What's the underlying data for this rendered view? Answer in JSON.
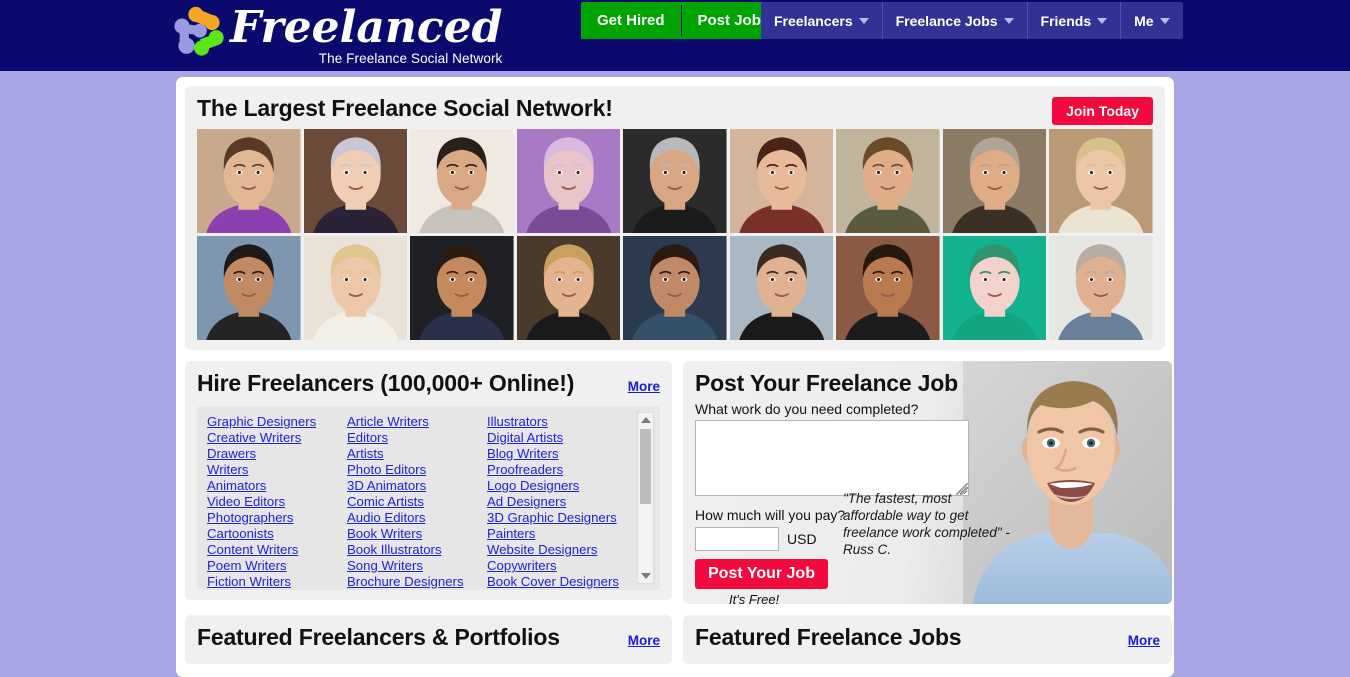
{
  "header": {
    "brand_name": "Freelanced",
    "brand_tagline": "The Freelance Social Network",
    "logo_icon": "molecule-network-icon",
    "cta": [
      {
        "label": "Get Hired",
        "name": "get-hired"
      },
      {
        "label": "Post Job",
        "name": "post-job"
      }
    ],
    "nav": [
      {
        "label": "Freelancers"
      },
      {
        "label": "Freelance Jobs"
      },
      {
        "label": "Friends"
      },
      {
        "label": "Me"
      }
    ],
    "colors": {
      "bar": "#0a0a6e",
      "nav": "#303394",
      "cta_green": "#00a400",
      "page_bg": "#a8a6e4"
    }
  },
  "hero": {
    "title": "The Largest Freelance Social Network!",
    "join_label": "Join Today",
    "join_color": "#f20a3f",
    "photo_count": 18,
    "grid": {
      "columns": 9,
      "rows": 2
    }
  },
  "hire": {
    "title": "Hire Freelancers (100,000+ Online!)",
    "more_label": "More",
    "columns": [
      [
        "Graphic Designers",
        "Creative Writers",
        "Drawers",
        "Writers",
        "Animators",
        "Video Editors",
        "Photographers",
        "Cartoonists",
        "Content Writers",
        "Poem Writers",
        "Fiction Writers"
      ],
      [
        "Article Writers",
        "Editors",
        "Artists",
        "Photo Editors",
        "3D Animators",
        "Comic Artists",
        "Audio Editors",
        "Book Writers",
        "Book Illustrators",
        "Song Writers",
        "Brochure Designers"
      ],
      [
        "Illustrators",
        "Digital Artists",
        "Blog Writers",
        "Proofreaders",
        "Logo Designers",
        "Ad Designers",
        "3D Graphic Designers",
        "Painters",
        "Website Designers",
        "Copywriters",
        "Book Cover Designers"
      ]
    ],
    "scrollbar": {
      "up_icon": "scroll-up-arrow-icon",
      "down_icon": "scroll-down-arrow-icon"
    }
  },
  "postjob": {
    "title": "Post Your Freelance Job",
    "work_label": "What work do you need completed?",
    "work_value": "",
    "work_placeholder": "",
    "pay_label": "How much will you pay?",
    "pay_value": "",
    "pay_placeholder": "",
    "currency": "USD",
    "submit_label": "Post Your Job",
    "free_note": "It's Free!",
    "testimonial": "\"The fastest, most affordable way to get freelance work completed\" - Russ C.",
    "photo": "smiling-man-photo"
  },
  "featured_freelancers": {
    "title": "Featured Freelancers & Portfolios",
    "more_label": "More"
  },
  "featured_jobs": {
    "title": "Featured Freelance Jobs",
    "more_label": "More"
  }
}
